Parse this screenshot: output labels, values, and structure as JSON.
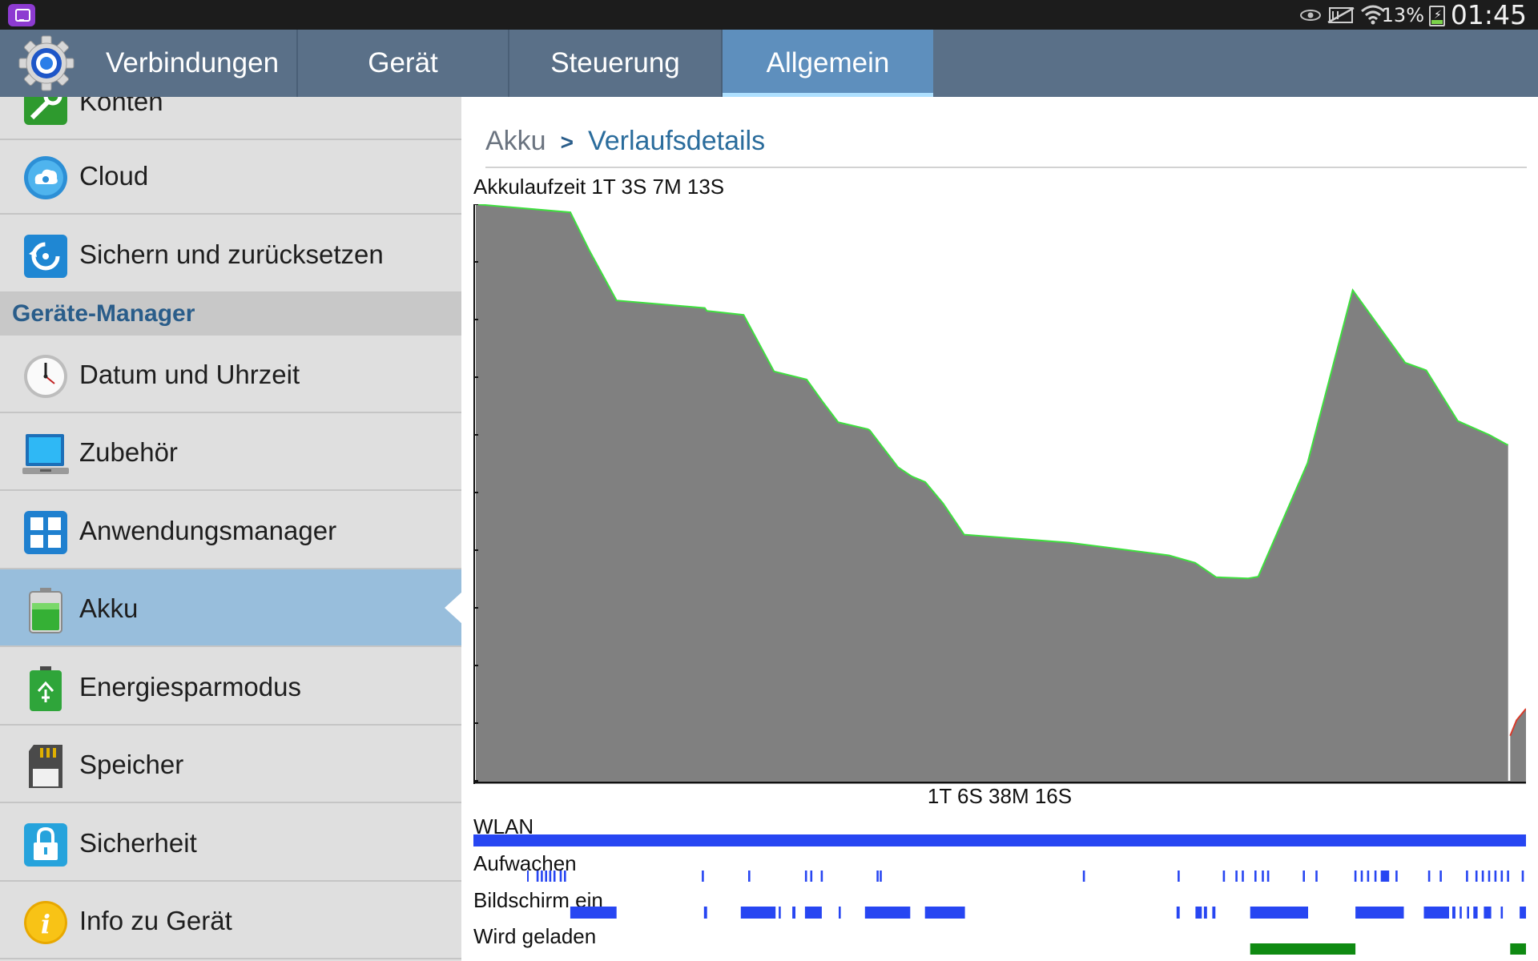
{
  "status_bar": {
    "battery_percent": "13%",
    "clock": "01:45",
    "icons": [
      "app-notification-icon",
      "eye-icon",
      "no-sim-icon",
      "wifi-icon",
      "battery-charging-icon"
    ]
  },
  "tabs": [
    {
      "label": "Verbindungen",
      "active": false
    },
    {
      "label": "Gerät",
      "active": false
    },
    {
      "label": "Steuerung",
      "active": false
    },
    {
      "label": "Allgemein",
      "active": true
    }
  ],
  "sidebar": {
    "items_top": [
      {
        "label": "Konten",
        "icon": "key-icon"
      },
      {
        "label": "Cloud",
        "icon": "cloud-icon"
      },
      {
        "label": "Sichern und zurücksetzen",
        "icon": "backup-reset-icon"
      }
    ],
    "section_header": "Geräte-Manager",
    "items": [
      {
        "label": "Datum und Uhrzeit",
        "icon": "clock-icon"
      },
      {
        "label": "Zubehör",
        "icon": "accessory-icon"
      },
      {
        "label": "Anwendungsmanager",
        "icon": "app-manager-icon"
      },
      {
        "label": "Akku",
        "icon": "battery-icon",
        "selected": true
      },
      {
        "label": "Energiesparmodus",
        "icon": "power-saving-icon"
      },
      {
        "label": "Speicher",
        "icon": "storage-icon"
      },
      {
        "label": "Sicherheit",
        "icon": "lock-icon"
      },
      {
        "label": "Info zu Gerät",
        "icon": "info-icon"
      }
    ]
  },
  "main": {
    "breadcrumb": {
      "parent": "Akku",
      "current": "Verlaufsdetails"
    },
    "akkulaufzeit": "Akkulaufzeit 1T 3S 7M 13S",
    "total_time": "1T 6S 38M 16S",
    "tracks": [
      {
        "label": "WLAN"
      },
      {
        "label": "Aufwachen"
      },
      {
        "label": "Bildschirm ein"
      },
      {
        "label": "Wird geladen"
      }
    ]
  },
  "colors": {
    "tabbar": "#5a7088",
    "tab_active": "#5e8fbd",
    "sidebar_bg": "#dfdfdf",
    "sidebar_selected": "#98bedc",
    "area_fill": "#808080",
    "area_line": "#3ee03e",
    "low_line": "#d83a2a",
    "track_blue": "#2746f2",
    "track_green": "#0f8a12"
  },
  "chart_data": {
    "type": "area",
    "title": "Akkulaufzeit 1T 3S 7M 13S",
    "xlabel": "1T 6S 38M 16S",
    "ylabel": "",
    "x_unit": "fraction of elapsed time (0 = start, 1 = now)",
    "y_unit": "battery level percent",
    "ylim": [
      0,
      100
    ],
    "series": [
      {
        "points": [
          [
            0.0,
            100.0
          ],
          [
            0.09,
            98.6
          ],
          [
            0.108,
            92.0
          ],
          [
            0.134,
            83.3
          ],
          [
            0.218,
            82.0
          ],
          [
            0.22,
            81.5
          ],
          [
            0.255,
            80.8
          ],
          [
            0.284,
            71.0
          ],
          [
            0.315,
            69.6
          ],
          [
            0.33,
            65.8
          ],
          [
            0.345,
            62.2
          ],
          [
            0.373,
            61.0
          ],
          [
            0.375,
            60.8
          ],
          [
            0.402,
            54.4
          ],
          [
            0.415,
            52.8
          ],
          [
            0.428,
            51.8
          ],
          [
            0.445,
            48.1
          ],
          [
            0.465,
            42.7
          ],
          [
            0.565,
            41.3
          ],
          [
            0.66,
            39.1
          ],
          [
            0.685,
            37.8
          ],
          [
            0.705,
            35.3
          ],
          [
            0.735,
            35.1
          ],
          [
            0.745,
            35.4
          ],
          [
            0.792,
            55.1
          ],
          [
            0.835,
            85.1
          ],
          [
            0.885,
            72.5
          ],
          [
            0.905,
            71.2
          ],
          [
            0.935,
            62.4
          ],
          [
            0.965,
            60.0
          ],
          [
            0.982,
            58.3
          ],
          [
            0.983,
            58.3
          ]
        ]
      },
      {
        "points": [
          [
            0.985,
            7.8
          ],
          [
            0.991,
            10.5
          ],
          [
            1.0,
            12.5
          ]
        ]
      }
    ],
    "tracks": {
      "WLAN": [
        [
          0.0,
          1.0
        ]
      ],
      "Aufwachen": [
        [
          0.051,
          0.052
        ],
        [
          0.06,
          0.062
        ],
        [
          0.064,
          0.066
        ],
        [
          0.068,
          0.07
        ],
        [
          0.072,
          0.074
        ],
        [
          0.076,
          0.078
        ],
        [
          0.082,
          0.084
        ],
        [
          0.086,
          0.088
        ],
        [
          0.217,
          0.219
        ],
        [
          0.261,
          0.263
        ],
        [
          0.315,
          0.317
        ],
        [
          0.32,
          0.322
        ],
        [
          0.33,
          0.332
        ],
        [
          0.383,
          0.385
        ],
        [
          0.386,
          0.388
        ],
        [
          0.579,
          0.581
        ],
        [
          0.669,
          0.671
        ],
        [
          0.712,
          0.714
        ],
        [
          0.724,
          0.726
        ],
        [
          0.73,
          0.732
        ],
        [
          0.742,
          0.744
        ],
        [
          0.749,
          0.751
        ],
        [
          0.754,
          0.756
        ],
        [
          0.788,
          0.79
        ],
        [
          0.8,
          0.802
        ],
        [
          0.837,
          0.839
        ],
        [
          0.843,
          0.845
        ],
        [
          0.849,
          0.851
        ],
        [
          0.856,
          0.858
        ],
        [
          0.862,
          0.87
        ],
        [
          0.876,
          0.878
        ],
        [
          0.907,
          0.909
        ],
        [
          0.918,
          0.92
        ],
        [
          0.943,
          0.945
        ],
        [
          0.952,
          0.954
        ],
        [
          0.958,
          0.96
        ],
        [
          0.964,
          0.966
        ],
        [
          0.97,
          0.972
        ],
        [
          0.976,
          0.978
        ],
        [
          0.982,
          0.984
        ],
        [
          0.996,
          0.998
        ]
      ],
      "Bildschirm ein": [
        [
          0.092,
          0.136
        ],
        [
          0.219,
          0.222
        ],
        [
          0.254,
          0.287
        ],
        [
          0.29,
          0.292
        ],
        [
          0.303,
          0.306
        ],
        [
          0.315,
          0.331
        ],
        [
          0.347,
          0.349
        ],
        [
          0.372,
          0.415
        ],
        [
          0.429,
          0.467
        ],
        [
          0.668,
          0.671
        ],
        [
          0.686,
          0.692
        ],
        [
          0.694,
          0.697
        ],
        [
          0.702,
          0.705
        ],
        [
          0.738,
          0.793
        ],
        [
          0.838,
          0.884
        ],
        [
          0.903,
          0.927
        ],
        [
          0.93,
          0.933
        ],
        [
          0.937,
          0.939
        ],
        [
          0.944,
          0.946
        ],
        [
          0.95,
          0.954
        ],
        [
          0.96,
          0.967
        ],
        [
          0.976,
          0.978
        ],
        [
          0.994,
          1.0
        ]
      ],
      "Wird geladen": [
        [
          0.738,
          0.838
        ],
        [
          0.985,
          1.0
        ]
      ]
    }
  }
}
